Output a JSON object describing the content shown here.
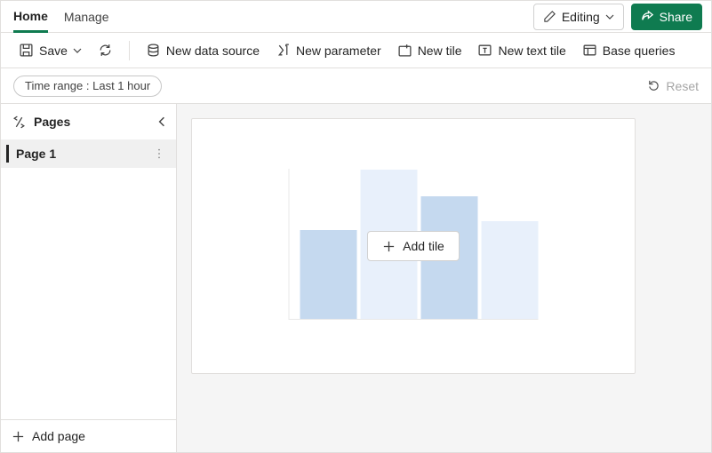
{
  "tabs": {
    "home": "Home",
    "manage": "Manage"
  },
  "top_actions": {
    "editing": "Editing",
    "share": "Share"
  },
  "toolbar": {
    "save": "Save",
    "new_data_source": "New data source",
    "new_parameter": "New parameter",
    "new_tile": "New tile",
    "new_text_tile": "New text tile",
    "base_queries": "Base queries"
  },
  "filter": {
    "time_range_label": "Time range :",
    "time_range_value": "Last 1 hour",
    "reset": "Reset"
  },
  "sidebar": {
    "title": "Pages",
    "items": [
      {
        "label": "Page 1"
      }
    ],
    "add_page": "Add page"
  },
  "canvas": {
    "add_tile": "Add tile"
  }
}
